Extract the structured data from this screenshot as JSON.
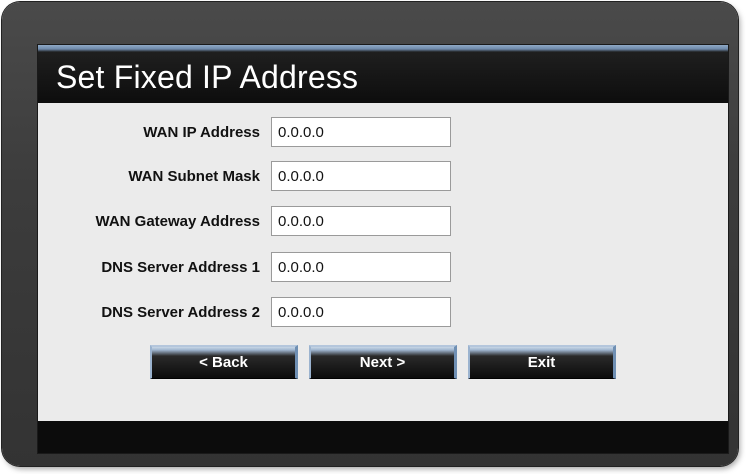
{
  "dialog": {
    "title": "Set Fixed IP Address"
  },
  "fields": [
    {
      "label": "WAN IP Address",
      "value": "0.0.0.0"
    },
    {
      "label": "WAN Subnet Mask",
      "value": "0.0.0.0"
    },
    {
      "label": "WAN Gateway Address",
      "value": "0.0.0.0"
    },
    {
      "label": "DNS Server Address 1",
      "value": "0.0.0.0"
    },
    {
      "label": "DNS Server Address 2",
      "value": "0.0.0.0"
    }
  ],
  "buttons": {
    "back": "< Back",
    "next": "Next >",
    "exit": "Exit"
  },
  "colors": {
    "frame": "#3c3c3c",
    "panel": "#ebebeb",
    "title_bar": "#0d0d0d",
    "accent": "#8fa9c6"
  }
}
